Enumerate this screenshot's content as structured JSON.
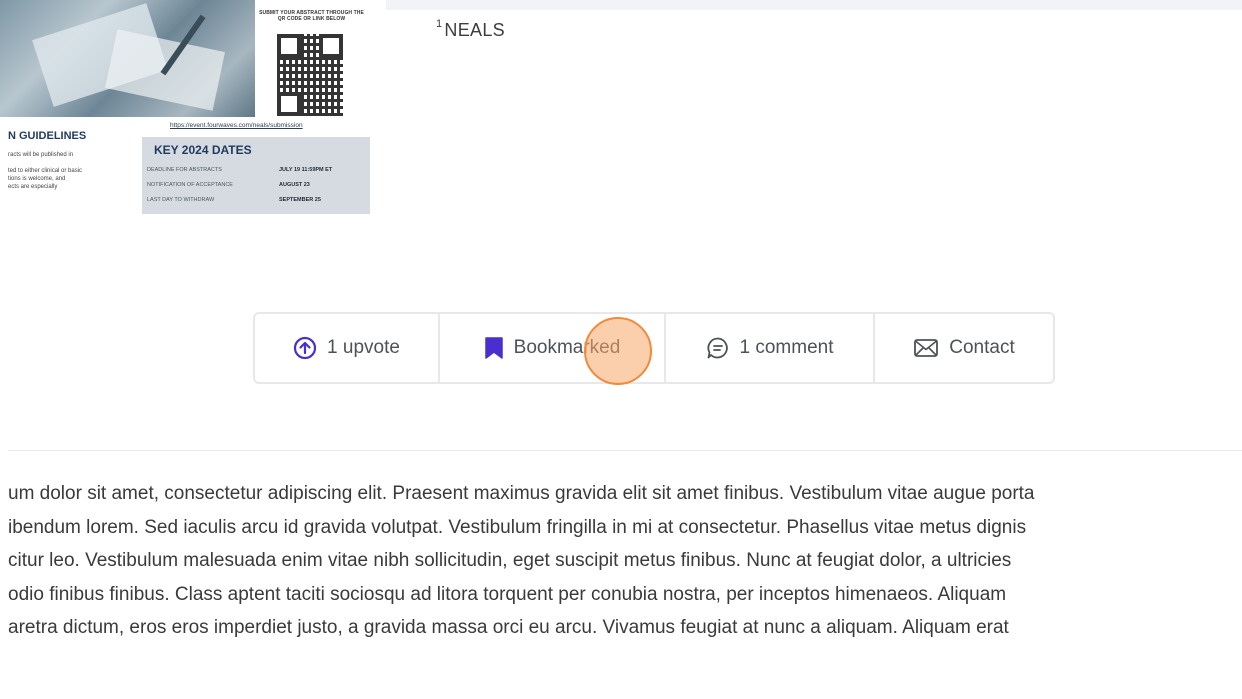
{
  "poster": {
    "submit_text": "SUBMIT YOUR ABSTRACT THROUGH THE QR CODE OR LINK BELOW",
    "link": "https://event.fourwaves.com/neals/submission",
    "guidelines_title": "N GUIDELINES",
    "guidelines_lines": [
      "racts will be published in",
      "",
      "ted to either clinical or basic",
      "tions is welcome, and",
      "ects are especially"
    ],
    "dates_title": "KEY 2024 DATES",
    "dates": [
      {
        "label": "DEADLINE FOR ABSTRACTS",
        "date": "JULY 19 11:59PM ET"
      },
      {
        "label": "NOTIFICATION OF ACCEPTANCE",
        "date": "AUGUST 23"
      },
      {
        "label": "LAST DAY TO WITHDRAW",
        "date": "SEPTEMBER 25"
      }
    ]
  },
  "affiliation": {
    "number": "1",
    "name": "NEALS"
  },
  "actions": {
    "upvote_label": "1 upvote",
    "bookmark_label": "Bookmarked",
    "comment_label": "1 comment",
    "contact_label": "Contact"
  },
  "colors": {
    "accent": "#4a2fd0",
    "border": "#e6e8ec",
    "cursor": "#f08a3c"
  },
  "body_text": [
    "um dolor sit amet, consectetur adipiscing elit. Praesent maximus gravida elit sit amet finibus. Vestibulum vitae augue porta",
    "ibendum lorem. Sed iaculis arcu id gravida volutpat. Vestibulum fringilla in mi at consectetur. Phasellus vitae metus dignis",
    "citur leo. Vestibulum malesuada enim vitae nibh sollicitudin, eget suscipit metus finibus. Nunc at feugiat dolor, a ultricies",
    "odio finibus finibus. Class aptent taciti sociosqu ad litora torquent per conubia nostra, per inceptos himenaeos. Aliquam",
    "aretra dictum, eros eros imperdiet justo, a gravida massa orci eu arcu. Vivamus feugiat at nunc a aliquam. Aliquam erat"
  ]
}
